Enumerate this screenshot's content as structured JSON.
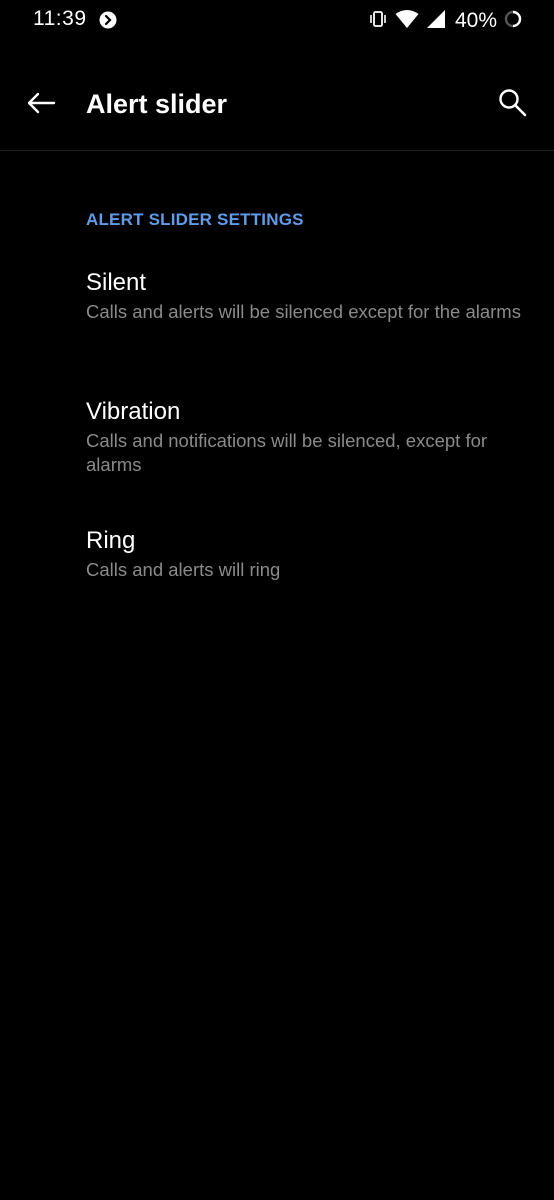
{
  "status_bar": {
    "time": "11:39",
    "left_icon": "shazam-icon",
    "icons": [
      "vibrate-icon",
      "wifi-icon",
      "cellular-signal-icon"
    ],
    "battery_percent": "40%",
    "battery_icon": "battery-ring-icon"
  },
  "app_bar": {
    "back_icon": "arrow-left-icon",
    "title": "Alert slider",
    "search_icon": "search-icon"
  },
  "section": {
    "header": "ALERT SLIDER SETTINGS"
  },
  "options": [
    {
      "title": "Silent",
      "description": "Calls and alerts will be silenced except for the alarms"
    },
    {
      "title": "Vibration",
      "description": "Calls and notifications will be silenced, except for alarms"
    },
    {
      "title": "Ring",
      "description": "Calls and alerts will ring"
    }
  ],
  "colors": {
    "background": "#000000",
    "accent": "#5f9be8",
    "primary_text": "#ffffff",
    "secondary_text": "#8a8a8a"
  }
}
